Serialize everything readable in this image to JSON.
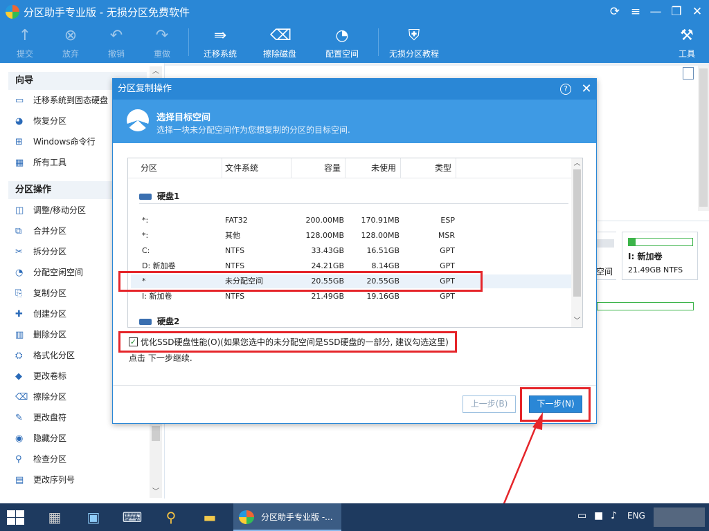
{
  "window": {
    "title": "分区助手专业版 - 无损分区免费软件",
    "controls": {
      "refresh": "⟳",
      "menu": "≡",
      "minimize": "—",
      "restore": "❐",
      "close": "✕"
    }
  },
  "toolbar": {
    "items": [
      {
        "label": "提交",
        "icon": "submit-icon",
        "enabled": false
      },
      {
        "label": "放弃",
        "icon": "discard-icon",
        "enabled": false
      },
      {
        "label": "撤销",
        "icon": "undo-icon",
        "enabled": false
      },
      {
        "label": "重做",
        "icon": "redo-icon",
        "enabled": false
      },
      {
        "label": "迁移系统",
        "icon": "migrate-os-icon",
        "enabled": true
      },
      {
        "label": "擦除磁盘",
        "icon": "wipe-disk-icon",
        "enabled": true
      },
      {
        "label": "配置空间",
        "icon": "allocate-space-icon",
        "enabled": true
      },
      {
        "label": "无损分区教程",
        "icon": "shield-icon",
        "enabled": true
      },
      {
        "label": "工具",
        "icon": "tools-icon",
        "enabled": true
      }
    ]
  },
  "sidebar": {
    "wizard_title": "向导",
    "wizard_items": [
      {
        "label": "迁移系统到固态硬盘",
        "icon": "ssd-icon"
      },
      {
        "label": "恢复分区",
        "icon": "restore-icon"
      },
      {
        "label": "Windows命令行",
        "icon": "windows-icon"
      },
      {
        "label": "所有工具",
        "icon": "grid-icon"
      }
    ],
    "ops_title": "分区操作",
    "ops_items": [
      {
        "label": "调整/移动分区",
        "icon": "resize-icon"
      },
      {
        "label": "合并分区",
        "icon": "merge-icon"
      },
      {
        "label": "拆分分区",
        "icon": "split-icon"
      },
      {
        "label": "分配空闲空间",
        "icon": "allocate-icon"
      },
      {
        "label": "复制分区",
        "icon": "copy-icon"
      },
      {
        "label": "创建分区",
        "icon": "create-icon"
      },
      {
        "label": "删除分区",
        "icon": "delete-icon"
      },
      {
        "label": "格式化分区",
        "icon": "format-icon"
      },
      {
        "label": "更改卷标",
        "icon": "label-icon"
      },
      {
        "label": "擦除分区",
        "icon": "wipe-icon"
      },
      {
        "label": "更改盘符",
        "icon": "drive-letter-icon"
      },
      {
        "label": "隐藏分区",
        "icon": "hide-icon"
      },
      {
        "label": "检查分区",
        "icon": "check-icon"
      },
      {
        "label": "更改序列号",
        "icon": "serial-icon"
      }
    ]
  },
  "background": {
    "card_partial_text": "空间",
    "card_title": "I: 新加卷",
    "card_sub": "21.49GB NTFS",
    "card_fill_fraction": 0.11
  },
  "dialog": {
    "title": "分区复制操作",
    "help": "?",
    "close": "✕",
    "heading": "选择目标空间",
    "subheading": "选择一块未分配空间作为您想复制的分区的目标空间.",
    "columns": [
      "分区",
      "文件系统",
      "容量",
      "未使用",
      "类型"
    ],
    "disk1": "硬盘1",
    "disk2": "硬盘2",
    "rows": [
      {
        "part": "*:",
        "fs": "FAT32",
        "cap": "200.00MB",
        "free": "170.91MB",
        "type": "ESP"
      },
      {
        "part": "*:",
        "fs": "其他",
        "cap": "128.00MB",
        "free": "128.00MB",
        "type": "MSR"
      },
      {
        "part": "C:",
        "fs": "NTFS",
        "cap": "33.43GB",
        "free": "16.51GB",
        "type": "GPT"
      },
      {
        "part": "D: 新加卷",
        "fs": "NTFS",
        "cap": "24.21GB",
        "free": "8.14GB",
        "type": "GPT"
      },
      {
        "part": "*",
        "fs": "未分配空间",
        "cap": "20.55GB",
        "free": "20.55GB",
        "type": "GPT"
      },
      {
        "part": "I: 新加卷",
        "fs": "NTFS",
        "cap": "21.49GB",
        "free": "19.16GB",
        "type": "GPT"
      }
    ],
    "optimize_label": "优化SSD硬盘性能(O)(如果您选中的未分配空间是SSD硬盘的一部分, 建议勾选这里)",
    "optimize_checked": "✓",
    "hint": "点击 下一步继续.",
    "prev_label": "上一步(B)",
    "next_label": "下一步(N)"
  },
  "taskbar": {
    "task_label": "分区助手专业版 -...",
    "lang": "ENG"
  },
  "colors": {
    "accent": "#2a87d6",
    "highlight_box": "#e5252a",
    "bar_green": "#3cb44a"
  }
}
